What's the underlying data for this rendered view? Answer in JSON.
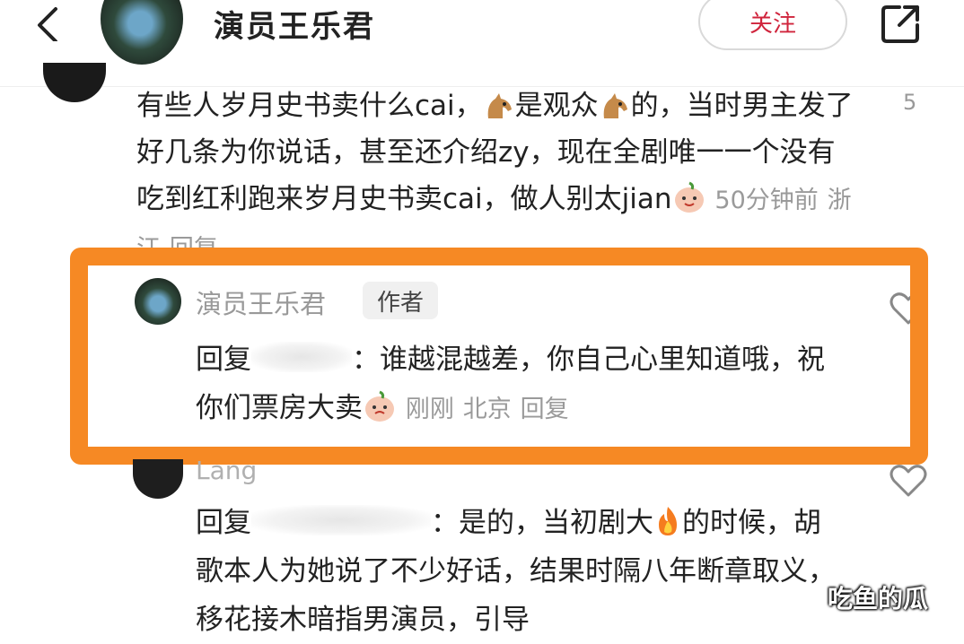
{
  "header": {
    "title": "演员王乐君",
    "follow_label": "关注"
  },
  "comment1": {
    "text_a": "有些人岁月史书卖什么cai，",
    "text_b": "是观众",
    "text_c": "的，当时男主发了好几条为你说话，甚至还介绍zy，现在全剧唯一一个没有吃到红利跑来岁月史书卖cai，做人别太jian",
    "time": "50分钟前",
    "location": "浙江",
    "reply_label": "回复",
    "like_count": "5"
  },
  "reply1": {
    "name": "演员王乐君",
    "badge": "作者",
    "prefix": "回复",
    "text": "：谁越混越差，你自己心里知道哦，祝你们票房大卖",
    "time": "刚刚",
    "location": "北京",
    "reply_label": "回复"
  },
  "reply2": {
    "name": "Lang",
    "prefix": "回复",
    "text_a": "：是的，当初剧大",
    "text_b": "的时候，胡歌本人为她说了不少好话，结果时隔八年断章取义，移花接木暗指男演员，引导"
  },
  "watermark": "吃鱼的瓜",
  "colors": {
    "highlight": "#f68924",
    "follow_text": "#d0243c",
    "meta_text": "#9a9a9a"
  },
  "icons": [
    "back-icon",
    "share-icon",
    "horse-emoji",
    "smile-emoji",
    "heart-icon",
    "fire-emoji"
  ]
}
